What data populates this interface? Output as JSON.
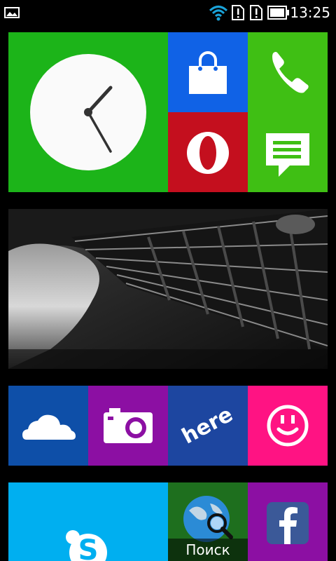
{
  "status_bar": {
    "time": "13:25",
    "icons": [
      "gallery-notification-icon",
      "wifi-icon",
      "sim1-alert-icon",
      "sim2-alert-icon",
      "battery-icon"
    ]
  },
  "tiles": {
    "clock": {
      "name": "clock-tile",
      "color": "#1cb419",
      "hour_hand_angle_deg": 45,
      "minute_hand_angle_deg": 150
    },
    "store": {
      "name": "store-tile",
      "color": "#1062e6",
      "icon": "shopping-bag-icon"
    },
    "phone": {
      "name": "phone-tile",
      "color": "#3fbf14",
      "icon": "phone-icon"
    },
    "opera": {
      "name": "opera-tile",
      "color": "#c40f1e",
      "icon": "opera-icon"
    },
    "messages": {
      "name": "messages-tile",
      "color": "#3fbf14",
      "icon": "message-bubble-icon"
    },
    "photo": {
      "name": "guitar-photo-tile",
      "icon": "guitar-photo"
    },
    "onedrive": {
      "name": "onedrive-tile",
      "color": "#0e4fa8",
      "icon": "cloud-icon"
    },
    "camera": {
      "name": "camera-tile",
      "color": "#8c0fa3",
      "icon": "camera-icon"
    },
    "here": {
      "name": "here-maps-tile",
      "color": "#1d46a0",
      "icon": "here-logo-icon",
      "logo_text": "here"
    },
    "mixradio": {
      "name": "mixradio-tile",
      "color": "#ff1383",
      "icon": "smiley-icon"
    },
    "skype": {
      "name": "skype-tile",
      "color": "#00aff0",
      "icon": "skype-icon"
    },
    "search": {
      "name": "search-tile",
      "color": "#1e6f1e",
      "icon": "globe-magnifier-icon",
      "label": "Поиск"
    },
    "facebook": {
      "name": "facebook-tile",
      "color": "#8c0fa3",
      "icon": "facebook-icon"
    }
  }
}
